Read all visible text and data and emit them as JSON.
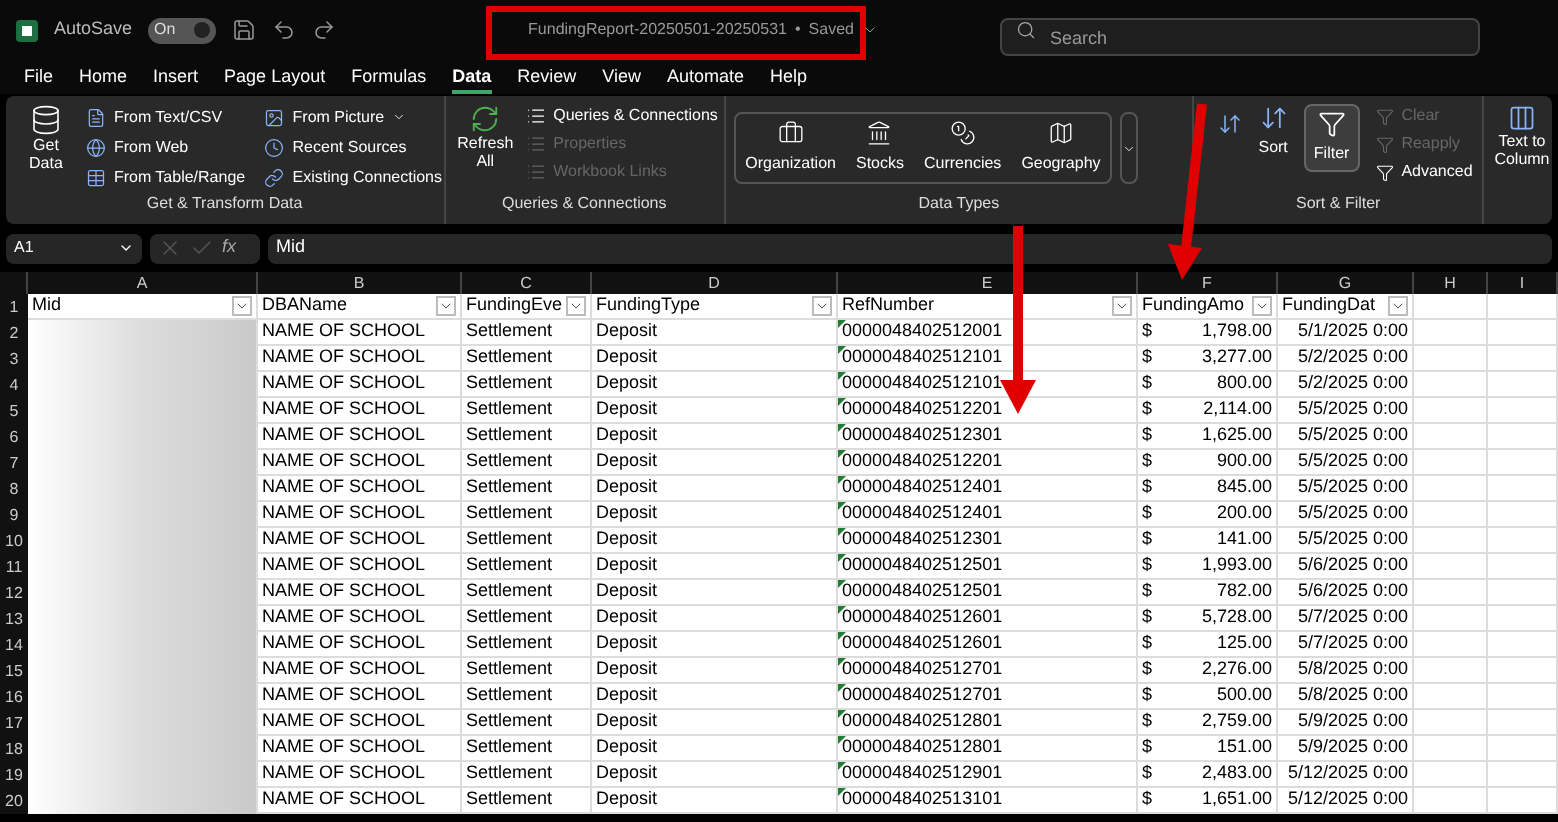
{
  "title_bar": {
    "autosave_label": "AutoSave",
    "autosave_toggle": {
      "label": "On",
      "on": true
    },
    "file_name": "FundingReport-20250501-20250531",
    "separator": "•",
    "save_status": "Saved",
    "search": {
      "placeholder": "Search"
    }
  },
  "menu_tabs": [
    {
      "label": "File",
      "selected": false
    },
    {
      "label": "Home",
      "selected": false
    },
    {
      "label": "Insert",
      "selected": false
    },
    {
      "label": "Page Layout",
      "selected": false
    },
    {
      "label": "Formulas",
      "selected": false
    },
    {
      "label": "Data",
      "selected": true
    },
    {
      "label": "Review",
      "selected": false
    },
    {
      "label": "View",
      "selected": false
    },
    {
      "label": "Automate",
      "selected": false
    },
    {
      "label": "Help",
      "selected": false
    }
  ],
  "ribbon": {
    "get_transform": {
      "get_data": "Get Data",
      "items": [
        {
          "label": "From Text/CSV"
        },
        {
          "label": "From Web"
        },
        {
          "label": "From Table/Range"
        },
        {
          "label": "From Picture",
          "menu": true
        },
        {
          "label": "Recent Sources"
        },
        {
          "label": "Existing Connections"
        }
      ],
      "title": "Get & Transform Data"
    },
    "queries": {
      "refresh": "Refresh All",
      "items": [
        {
          "label": "Queries & Connections",
          "disabled": false
        },
        {
          "label": "Properties",
          "disabled": true
        },
        {
          "label": "Workbook Links",
          "disabled": true
        }
      ],
      "title": "Queries & Connections"
    },
    "data_types": {
      "items": [
        {
          "label": "Organization"
        },
        {
          "label": "Stocks"
        },
        {
          "label": "Currencies"
        },
        {
          "label": "Geography"
        }
      ],
      "title": "Data Types"
    },
    "sort_filter": {
      "sort": "Sort",
      "filter": {
        "label": "Filter",
        "selected": true
      },
      "items": [
        {
          "label": "Clear",
          "disabled": true
        },
        {
          "label": "Reapply",
          "disabled": true
        },
        {
          "label": "Advanced",
          "disabled": false
        }
      ],
      "title": "Sort & Filter"
    },
    "text_to_columns": "Text to Column"
  },
  "formula_bar": {
    "name_box": "A1",
    "function_label": "fx",
    "formula": "Mid"
  },
  "columns": [
    "A",
    "B",
    "C",
    "D",
    "E",
    "F",
    "G",
    "H",
    "I"
  ],
  "header_row": {
    "num": "1",
    "cells": [
      "Mid",
      "DBAName",
      "FundingEve",
      "FundingType",
      "RefNumber",
      "FundingAmo",
      "FundingDat"
    ]
  },
  "rows": [
    {
      "num": "2",
      "redacted": true,
      "dba": "NAME OF SCHOOL",
      "event": "Settlement",
      "type": "Deposit",
      "ref": "0000048402512001",
      "flag": true,
      "currency": "$",
      "amount": "1,798.00",
      "date": "5/1/2025 0:00"
    },
    {
      "num": "3",
      "redacted": true,
      "dba": "NAME OF SCHOOL",
      "event": "Settlement",
      "type": "Deposit",
      "ref": "0000048402512101",
      "flag": true,
      "currency": "$",
      "amount": "3,277.00",
      "date": "5/2/2025 0:00"
    },
    {
      "num": "4",
      "redacted": true,
      "dba": "NAME OF SCHOOL",
      "event": "Settlement",
      "type": "Deposit",
      "ref": "0000048402512101",
      "flag": true,
      "currency": "$",
      "amount": "800.00",
      "date": "5/2/2025 0:00"
    },
    {
      "num": "5",
      "redacted": true,
      "dba": "NAME OF SCHOOL",
      "event": "Settlement",
      "type": "Deposit",
      "ref": "0000048402512201",
      "flag": true,
      "currency": "$",
      "amount": "2,114.00",
      "date": "5/5/2025 0:00"
    },
    {
      "num": "6",
      "redacted": true,
      "dba": "NAME OF SCHOOL",
      "event": "Settlement",
      "type": "Deposit",
      "ref": "0000048402512301",
      "flag": true,
      "currency": "$",
      "amount": "1,625.00",
      "date": "5/5/2025 0:00"
    },
    {
      "num": "7",
      "redacted": true,
      "dba": "NAME OF SCHOOL",
      "event": "Settlement",
      "type": "Deposit",
      "ref": "0000048402512201",
      "flag": true,
      "currency": "$",
      "amount": "900.00",
      "date": "5/5/2025 0:00"
    },
    {
      "num": "8",
      "redacted": true,
      "dba": "NAME OF SCHOOL",
      "event": "Settlement",
      "type": "Deposit",
      "ref": "0000048402512401",
      "flag": true,
      "currency": "$",
      "amount": "845.00",
      "date": "5/5/2025 0:00"
    },
    {
      "num": "9",
      "redacted": true,
      "dba": "NAME OF SCHOOL",
      "event": "Settlement",
      "type": "Deposit",
      "ref": "0000048402512401",
      "flag": true,
      "currency": "$",
      "amount": "200.00",
      "date": "5/5/2025 0:00"
    },
    {
      "num": "10",
      "redacted": true,
      "dba": "NAME OF SCHOOL",
      "event": "Settlement",
      "type": "Deposit",
      "ref": "0000048402512301",
      "flag": true,
      "currency": "$",
      "amount": "141.00",
      "date": "5/5/2025 0:00"
    },
    {
      "num": "11",
      "redacted": true,
      "dba": "NAME OF SCHOOL",
      "event": "Settlement",
      "type": "Deposit",
      "ref": "0000048402512501",
      "flag": true,
      "currency": "$",
      "amount": "1,993.00",
      "date": "5/6/2025 0:00"
    },
    {
      "num": "12",
      "redacted": true,
      "dba": "NAME OF SCHOOL",
      "event": "Settlement",
      "type": "Deposit",
      "ref": "0000048402512501",
      "flag": true,
      "currency": "$",
      "amount": "782.00",
      "date": "5/6/2025 0:00"
    },
    {
      "num": "13",
      "redacted": true,
      "dba": "NAME OF SCHOOL",
      "event": "Settlement",
      "type": "Deposit",
      "ref": "0000048402512601",
      "flag": true,
      "currency": "$",
      "amount": "5,728.00",
      "date": "5/7/2025 0:00"
    },
    {
      "num": "14",
      "redacted": true,
      "dba": "NAME OF SCHOOL",
      "event": "Settlement",
      "type": "Deposit",
      "ref": "0000048402512601",
      "flag": true,
      "currency": "$",
      "amount": "125.00",
      "date": "5/7/2025 0:00"
    },
    {
      "num": "15",
      "redacted": true,
      "dba": "NAME OF SCHOOL",
      "event": "Settlement",
      "type": "Deposit",
      "ref": "0000048402512701",
      "flag": true,
      "currency": "$",
      "amount": "2,276.00",
      "date": "5/8/2025 0:00"
    },
    {
      "num": "16",
      "redacted": true,
      "dba": "NAME OF SCHOOL",
      "event": "Settlement",
      "type": "Deposit",
      "ref": "0000048402512701",
      "flag": true,
      "currency": "$",
      "amount": "500.00",
      "date": "5/8/2025 0:00"
    },
    {
      "num": "17",
      "redacted": true,
      "dba": "NAME OF SCHOOL",
      "event": "Settlement",
      "type": "Deposit",
      "ref": "0000048402512801",
      "flag": true,
      "currency": "$",
      "amount": "2,759.00",
      "date": "5/9/2025 0:00"
    },
    {
      "num": "18",
      "redacted": true,
      "dba": "NAME OF SCHOOL",
      "event": "Settlement",
      "type": "Deposit",
      "ref": "0000048402512801",
      "flag": true,
      "currency": "$",
      "amount": "151.00",
      "date": "5/9/2025 0:00"
    },
    {
      "num": "19",
      "redacted": true,
      "dba": "NAME OF SCHOOL",
      "event": "Settlement",
      "type": "Deposit",
      "ref": "0000048402512901",
      "flag": true,
      "currency": "$",
      "amount": "2,483.00",
      "date": "5/12/2025 0:00"
    },
    {
      "num": "20",
      "redacted": true,
      "dba": "NAME OF SCHOOL",
      "event": "Settlement",
      "type": "Deposit",
      "ref": "0000048402513101",
      "flag": true,
      "currency": "$",
      "amount": "1,651.00",
      "date": "5/12/2025 0:00"
    }
  ]
}
